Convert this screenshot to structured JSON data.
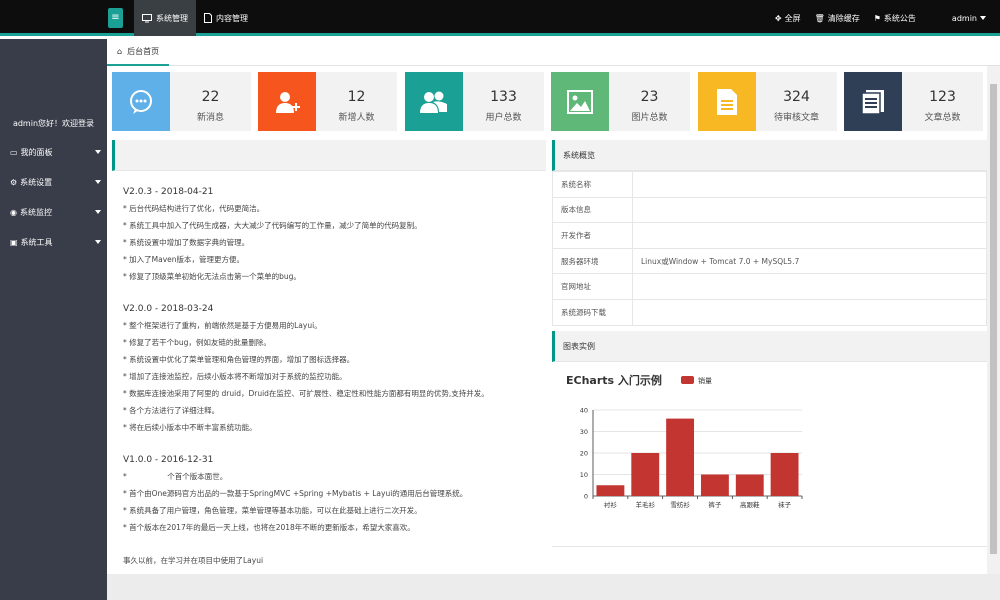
{
  "header": {
    "nav": [
      {
        "label": "系统管理",
        "icon": "monitor-icon",
        "active": true
      },
      {
        "label": "内容管理",
        "icon": "document-icon",
        "active": false
      }
    ],
    "right": [
      {
        "label": "全屏",
        "icon": "fullscreen-icon"
      },
      {
        "label": "清除缓存",
        "icon": "trash-icon"
      },
      {
        "label": "系统公告",
        "icon": "bell-icon"
      }
    ],
    "user": "admin"
  },
  "sidebar": {
    "welcome": "admin您好！欢迎登录",
    "items": [
      {
        "label": "我的面板",
        "icon": "monitor-icon"
      },
      {
        "label": "系统设置",
        "icon": "gears-icon"
      },
      {
        "label": "系统监控",
        "icon": "eye-icon"
      },
      {
        "label": "系统工具",
        "icon": "tools-icon"
      }
    ]
  },
  "tabs": [
    {
      "label": "后台首页",
      "icon": "home-icon"
    }
  ],
  "stats": [
    {
      "value": "22",
      "label": "新消息",
      "color": "#5fb0e8",
      "icon": "message-icon"
    },
    {
      "value": "12",
      "label": "新增人数",
      "color": "#f6561d",
      "icon": "add-user-icon"
    },
    {
      "value": "133",
      "label": "用户总数",
      "color": "#1aa094",
      "icon": "users-icon"
    },
    {
      "value": "23",
      "label": "图片总数",
      "color": "#5fb878",
      "icon": "image-icon"
    },
    {
      "value": "324",
      "label": "待审核文章",
      "color": "#f7b824",
      "icon": "file-icon"
    },
    {
      "value": "123",
      "label": "文章总数",
      "color": "#2f4056",
      "icon": "article-icon"
    }
  ],
  "log": {
    "versions": [
      {
        "title": "V2.0.3 - 2018-04-21",
        "lines": [
          "* 后台代码结构进行了优化，代码更简洁。",
          "* 系统工具中加入了代码生成器，大大减少了代码编写的工作量，减少了简单的代码复制。",
          "* 系统设置中增加了数据字典的管理。",
          "* 加入了Maven版本，管理更方便。",
          "* 修复了顶级菜单初始化无法点击第一个菜单的bug。"
        ]
      },
      {
        "title": "V2.0.0 - 2018-03-24",
        "lines": [
          "* 整个框架进行了重构，前端依然是基于方便易用的Layui。",
          "* 修复了若干个bug，例如友链的批量删除。",
          "* 系统设置中优化了菜单管理和角色管理的界面，增加了图标选择器。",
          "* 增加了连接池监控，后续小版本将不断增加对于系统的监控功能。",
          "* 数据库连接池采用了阿里的 druid，Druid在监控、可扩展性、稳定性和性能方面都有明显的优势,支持并发。",
          "* 各个方法进行了详细注释。",
          "* 将在后续小版本中不断丰富系统功能。"
        ]
      },
      {
        "title": "V1.0.0 - 2016-12-31",
        "lines": [
          "*                 个首个版本面世。",
          "* 首个由One源码官方出品的一款基于SpringMVC +Spring +Mybatis + Layui的通用后台管理系统。",
          "* 系统具备了用户管理，角色管理，菜单管理等基本功能，可以在此基础上进行二次开发。",
          "* 首个版本在2017年的最后一天上线，也将在2018年不断的更新版本，希望大家喜欢。"
        ]
      }
    ],
    "footer": "事久以前，在学习并在项目中使用了Layui"
  },
  "system": {
    "title": "系统概览",
    "rows": [
      {
        "key": "系统名称",
        "value": ""
      },
      {
        "key": "版本信息",
        "value": ""
      },
      {
        "key": "开发作者",
        "value": ""
      },
      {
        "key": "服务器环境",
        "value": "Linux或Window + Tomcat 7.0 + MySQL5.7"
      },
      {
        "key": "官网地址",
        "value": ""
      },
      {
        "key": "系统源码下载",
        "value": ""
      }
    ]
  },
  "chart_panel": {
    "title": "图表实例"
  },
  "chart_data": {
    "type": "bar",
    "title": "ECharts 入门示例",
    "categories": [
      "衬衫",
      "羊毛衫",
      "雪纺衫",
      "裤子",
      "高跟鞋",
      "袜子"
    ],
    "series": [
      {
        "name": "销量",
        "values": [
          5,
          20,
          36,
          10,
          10,
          20
        ],
        "color": "#c23531"
      }
    ],
    "ylim": [
      0,
      40
    ],
    "yticks": [
      0,
      10,
      20,
      30,
      40
    ],
    "legend": "top-center",
    "grid": true
  }
}
